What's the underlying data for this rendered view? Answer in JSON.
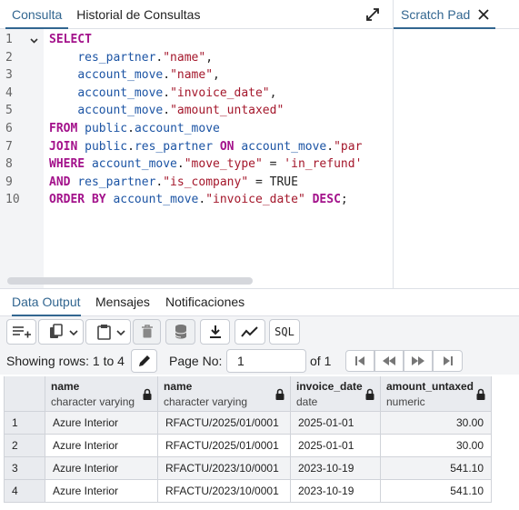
{
  "query_tool": {
    "tabs": [
      {
        "label": "Consulta",
        "active": true
      },
      {
        "label": "Historial de Consultas",
        "active": false
      }
    ],
    "scratch_pad": {
      "label": "Scratch Pad"
    }
  },
  "editor": {
    "line_numbers": [
      "1",
      "2",
      "3",
      "4",
      "5",
      "6",
      "7",
      "8",
      "9",
      "10"
    ],
    "lines": [
      [
        {
          "t": "SELECT",
          "c": "kw"
        }
      ],
      [
        {
          "t": "    "
        },
        {
          "t": "res_partner",
          "c": "idn"
        },
        {
          "t": "."
        },
        {
          "t": "\"name\"",
          "c": "str"
        },
        {
          "t": ","
        }
      ],
      [
        {
          "t": "    "
        },
        {
          "t": "account_move",
          "c": "idn"
        },
        {
          "t": "."
        },
        {
          "t": "\"name\"",
          "c": "str"
        },
        {
          "t": ","
        }
      ],
      [
        {
          "t": "    "
        },
        {
          "t": "account_move",
          "c": "idn"
        },
        {
          "t": "."
        },
        {
          "t": "\"invoice_date\"",
          "c": "str"
        },
        {
          "t": ","
        }
      ],
      [
        {
          "t": "    "
        },
        {
          "t": "account_move",
          "c": "idn"
        },
        {
          "t": "."
        },
        {
          "t": "\"amount_untaxed\"",
          "c": "str"
        }
      ],
      [
        {
          "t": "FROM",
          "c": "kw"
        },
        {
          "t": " "
        },
        {
          "t": "public",
          "c": "idn"
        },
        {
          "t": "."
        },
        {
          "t": "account_move",
          "c": "idn"
        }
      ],
      [
        {
          "t": "JOIN",
          "c": "kw"
        },
        {
          "t": " "
        },
        {
          "t": "public",
          "c": "idn"
        },
        {
          "t": "."
        },
        {
          "t": "res_partner",
          "c": "idn"
        },
        {
          "t": " "
        },
        {
          "t": "ON",
          "c": "kw"
        },
        {
          "t": " "
        },
        {
          "t": "account_move",
          "c": "idn"
        },
        {
          "t": "."
        },
        {
          "t": "\"par",
          "c": "str"
        }
      ],
      [
        {
          "t": "WHERE",
          "c": "kw"
        },
        {
          "t": " "
        },
        {
          "t": "account_move",
          "c": "idn"
        },
        {
          "t": "."
        },
        {
          "t": "\"move_type\"",
          "c": "str"
        },
        {
          "t": " = "
        },
        {
          "t": "'in_refund'",
          "c": "str"
        }
      ],
      [
        {
          "t": "AND",
          "c": "kw"
        },
        {
          "t": " "
        },
        {
          "t": "res_partner",
          "c": "idn"
        },
        {
          "t": "."
        },
        {
          "t": "\"is_company\"",
          "c": "str"
        },
        {
          "t": " = TRUE"
        }
      ],
      [
        {
          "t": "ORDER BY",
          "c": "kw"
        },
        {
          "t": " "
        },
        {
          "t": "account_move",
          "c": "idn"
        },
        {
          "t": "."
        },
        {
          "t": "\"invoice_date\"",
          "c": "str"
        },
        {
          "t": " "
        },
        {
          "t": "DESC",
          "c": "kw"
        },
        {
          "t": ";"
        }
      ]
    ]
  },
  "output": {
    "tabs": [
      {
        "label": "Data Output",
        "active": true
      },
      {
        "label": "Mensajes",
        "active": false
      },
      {
        "label": "Notificaciones",
        "active": false
      }
    ],
    "toolbar": {
      "sql_label": "SQL"
    },
    "pager": {
      "showing_rows": "Showing rows: 1 to 4",
      "page_no_label": "Page No:",
      "page_no_value": "1",
      "of_label": "of 1"
    },
    "columns": [
      {
        "name": "name",
        "type": "character varying"
      },
      {
        "name": "name",
        "type": "character varying"
      },
      {
        "name": "invoice_date",
        "type": "date"
      },
      {
        "name": "amount_untaxed",
        "type": "numeric"
      }
    ],
    "rows": [
      {
        "num": "1",
        "cells": [
          "Azure Interior",
          "RFACTU/2025/01/0001",
          "2025-01-01",
          "30.00"
        ]
      },
      {
        "num": "2",
        "cells": [
          "Azure Interior",
          "RFACTU/2025/01/0001",
          "2025-01-01",
          "30.00"
        ]
      },
      {
        "num": "3",
        "cells": [
          "Azure Interior",
          "RFACTU/2023/10/0001",
          "2023-10-19",
          "541.10"
        ]
      },
      {
        "num": "4",
        "cells": [
          "Azure Interior",
          "RFACTU/2023/10/0001",
          "2023-10-19",
          "541.10"
        ]
      }
    ]
  }
}
